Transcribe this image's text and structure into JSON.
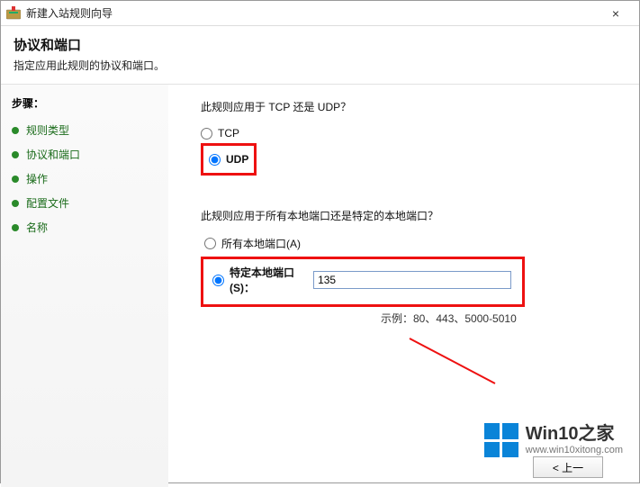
{
  "window": {
    "title": "新建入站规则向导",
    "close_symbol": "×"
  },
  "header": {
    "title": "协议和端口",
    "subtitle": "指定应用此规则的协议和端口。"
  },
  "sidebar": {
    "steps_label": "步骤：",
    "items": [
      {
        "label": "规则类型"
      },
      {
        "label": "协议和端口"
      },
      {
        "label": "操作"
      },
      {
        "label": "配置文件"
      },
      {
        "label": "名称"
      }
    ]
  },
  "content": {
    "question1": "此规则应用于 TCP 还是 UDP？",
    "protocol": {
      "tcp_label": "TCP",
      "udp_label": "UDP",
      "selected": "udp"
    },
    "question2": "此规则应用于所有本地端口还是特定的本地端口？",
    "port_scope": {
      "all_label": "所有本地端口(A)",
      "specific_label": "特定本地端口(S)：",
      "selected": "specific",
      "value": "135",
      "example_label": "示例：80、443、5000-5010"
    }
  },
  "footer": {
    "back_label": "< 上一"
  },
  "watermark": {
    "brand": "Win10之家",
    "url": "www.win10xitong.com"
  }
}
